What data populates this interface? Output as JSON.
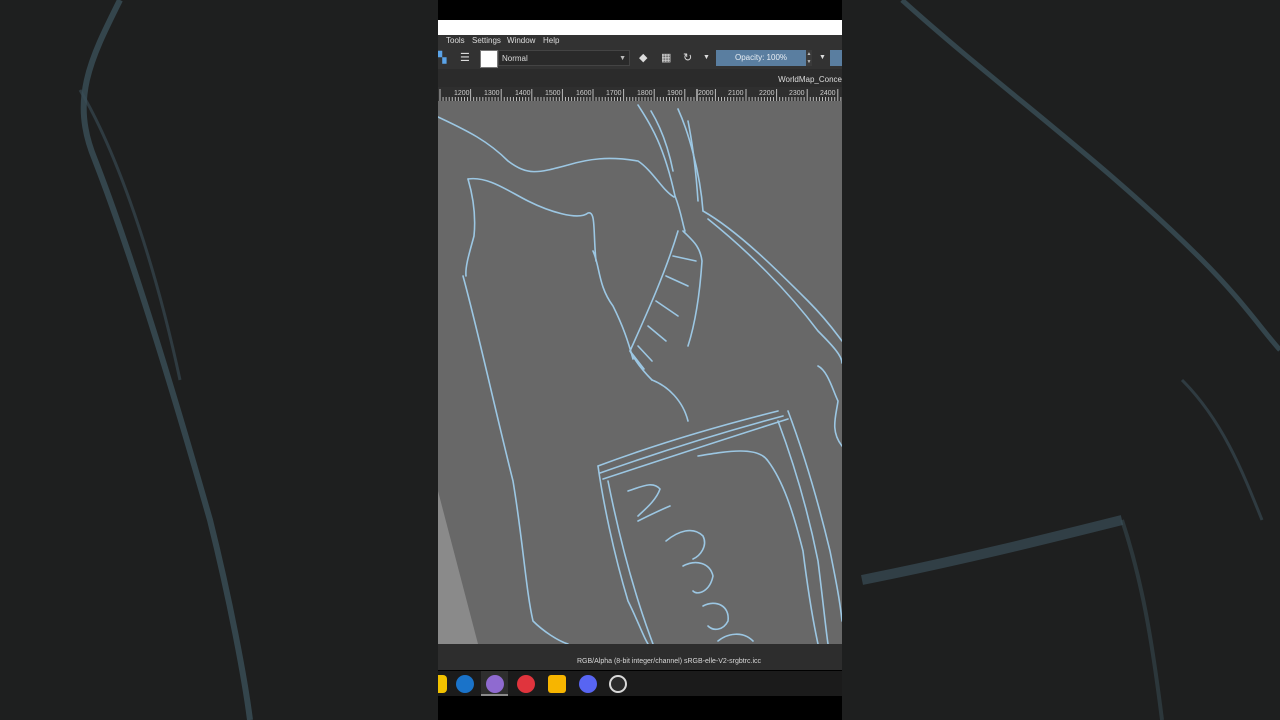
{
  "menu": {
    "tools": "Tools",
    "settings": "Settings",
    "window": "Window",
    "help": "Help"
  },
  "toolbar": {
    "blend_mode": "Normal",
    "opacity_label": "Opacity: 100%",
    "icons": [
      "brush-presets-icon",
      "brush-settings-icon",
      "eraser-icon",
      "alpha-lock-icon",
      "reload-preset-icon"
    ]
  },
  "document": {
    "title": "WorldMap_Conce"
  },
  "ruler": {
    "labels": [
      "1200",
      "1300",
      "1400",
      "1500",
      "1600",
      "1700",
      "1800",
      "1900",
      "2000",
      "2100",
      "2200",
      "2300",
      "2400"
    ]
  },
  "status": {
    "color_info": "RGB/Alpha (8-bit integer/channel)  sRGB-elle-V2-srgbtrc.icc"
  },
  "taskbar": {
    "icons": [
      "folder-icon",
      "edge-icon",
      "krita-icon",
      "vivaldi-icon",
      "chrome-icon",
      "discord-icon",
      "obs-icon"
    ]
  },
  "colors": {
    "canvas": "#686868",
    "stroke": "#9cc7e3",
    "panel": "#323232",
    "accent": "#5a7ea0",
    "background": "#1f1f1f"
  }
}
